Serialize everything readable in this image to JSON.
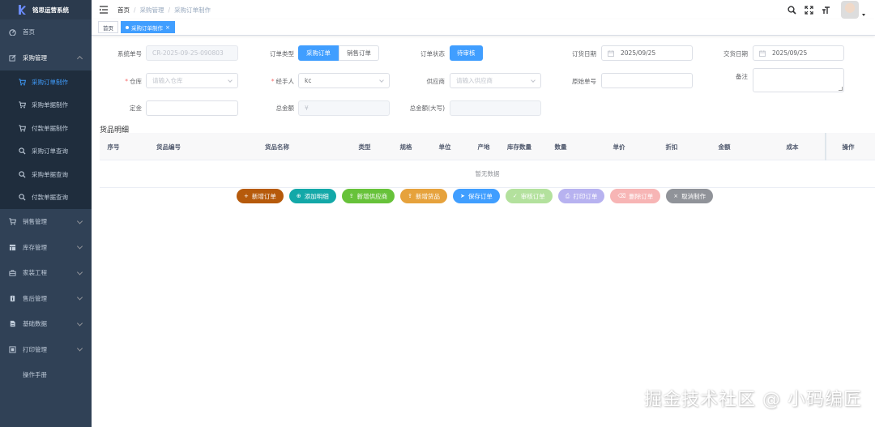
{
  "app": {
    "title": "铭思运营系统"
  },
  "sidebar": {
    "items": [
      {
        "label": "首页",
        "icon": "dashboard-icon"
      },
      {
        "label": "采购管理",
        "icon": "edit-icon",
        "expanded": true,
        "children": [
          {
            "label": "采购订单制作",
            "icon": "cart-icon",
            "active": true
          },
          {
            "label": "采购单据制作",
            "icon": "cart-icon"
          },
          {
            "label": "付款单据制作",
            "icon": "cart-icon"
          },
          {
            "label": "采购订单查询",
            "icon": "search-icon"
          },
          {
            "label": "采购单据查询",
            "icon": "search-icon"
          },
          {
            "label": "付款单据查询",
            "icon": "search-icon"
          }
        ]
      },
      {
        "label": "销售管理",
        "icon": "cart-icon"
      },
      {
        "label": "库存管理",
        "icon": "table-icon"
      },
      {
        "label": "家装工程",
        "icon": "toolbox-icon"
      },
      {
        "label": "售后管理",
        "icon": "info-icon"
      },
      {
        "label": "基础数据",
        "icon": "documentation-icon"
      },
      {
        "label": "打印管理",
        "icon": "monitor-icon"
      },
      {
        "label": "操作手册",
        "icon": ""
      }
    ]
  },
  "breadcrumb": [
    "首页",
    "采购管理",
    "采购订单制作"
  ],
  "tags": [
    {
      "label": "首页",
      "active": false
    },
    {
      "label": "采购订单制作",
      "active": true,
      "close": "×"
    }
  ],
  "form": {
    "sys_no": {
      "label": "系统单号",
      "value": "CR-2025-09-25-090803"
    },
    "order_type": {
      "label": "订单类型",
      "options": [
        "采购订单",
        "销售订单"
      ],
      "selected": "采购订单"
    },
    "order_status": {
      "label": "订单状态",
      "value": "待审核"
    },
    "order_date": {
      "label": "订货日期",
      "value": "2025/09/25"
    },
    "delivery_date": {
      "label": "交货日期",
      "value": "2025/09/25"
    },
    "warehouse": {
      "label": "仓库",
      "required": "*",
      "placeholder": "请输入仓库"
    },
    "handler": {
      "label": "经手人",
      "required": "*",
      "value": "kc"
    },
    "supplier": {
      "label": "供应商",
      "placeholder": "请输入供应商"
    },
    "original_no": {
      "label": "原始单号",
      "value": ""
    },
    "remark": {
      "label": "备注",
      "value": ""
    },
    "deposit": {
      "label": "定金",
      "value": ""
    },
    "total": {
      "label": "总金额",
      "value": "¥"
    },
    "total_upper": {
      "label": "总金额(大写)",
      "value": ""
    }
  },
  "details": {
    "title": "货品明细",
    "columns": [
      "序号",
      "货品编号",
      "货品名称",
      "类型",
      "规格",
      "单位",
      "产地",
      "库存数量",
      "数量",
      "单价",
      "折扣",
      "金额",
      "成本",
      "操作"
    ],
    "empty_text": "暂无数据"
  },
  "actions": [
    {
      "label": "新增订单",
      "icon": "+",
      "color": "#b65a0b"
    },
    {
      "label": "添加明细",
      "icon": "⊕",
      "color": "#13a8a8"
    },
    {
      "label": "新增供应商",
      "icon": "⇪",
      "color": "#67c23a"
    },
    {
      "label": "新增货品",
      "icon": "⇪",
      "color": "#e6a23c"
    },
    {
      "label": "保存订单",
      "icon": "➤",
      "color": "#409eff"
    },
    {
      "label": "审核订单",
      "icon": "✓",
      "color": "#b3e19d"
    },
    {
      "label": "打印订单",
      "icon": "⎙",
      "color": "#b7b2f0"
    },
    {
      "label": "删除订单",
      "icon": "⌫",
      "color": "#f7b5b5"
    },
    {
      "label": "取消制作",
      "icon": "×",
      "color": "#909399"
    }
  ],
  "watermark": "掘金技术社区 @ 小码编匠"
}
